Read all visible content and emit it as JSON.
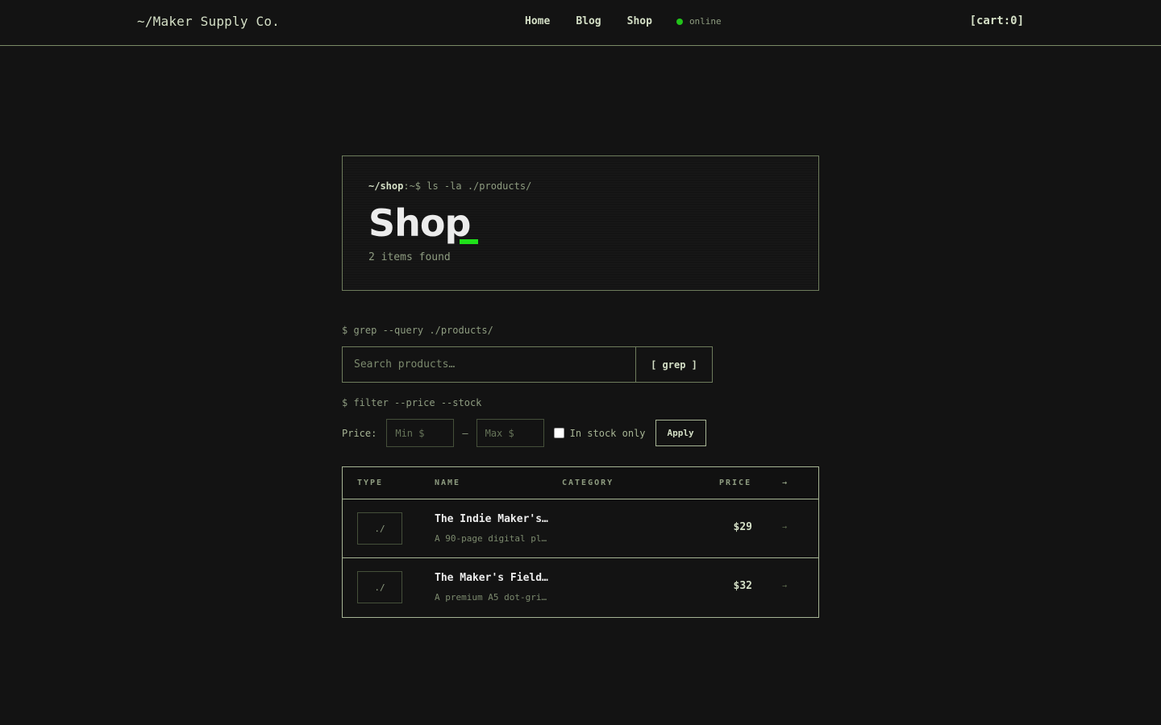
{
  "header": {
    "brand": "~/Maker Supply Co.",
    "nav": [
      "Home",
      "Blog",
      "Shop"
    ],
    "status": "online",
    "cart": "[cart:0]"
  },
  "hero": {
    "prompt_path": "~/shop",
    "prompt_cmd": ":~$ ls -la ./products/",
    "title": "Shop",
    "count": "2 items found"
  },
  "search": {
    "cmd": "$ grep --query ./products/",
    "placeholder": "Search products…",
    "button": "[ grep ]"
  },
  "filters": {
    "cmd": "$ filter --price --stock",
    "price_label": "Price:",
    "min_placeholder": "Min $",
    "dash": "—",
    "max_placeholder": "Max $",
    "in_stock_label": "In stock only",
    "in_stock_checked": false,
    "apply": "Apply"
  },
  "table": {
    "headers": [
      "TYPE",
      "NAME",
      "CATEGORY",
      "PRICE",
      "→"
    ],
    "rows": [
      {
        "type": "./",
        "name": "The Indie Maker's…",
        "desc": "A 90-page digital pl…",
        "category": "",
        "price": "$29",
        "arrow": "→"
      },
      {
        "type": "./",
        "name": "The Maker's Field…",
        "desc": "A premium A5 dot-gri…",
        "category": "",
        "price": "$32",
        "arrow": "→"
      }
    ]
  },
  "colors": {
    "background": "#131313",
    "accent": "#1fe01a",
    "border": "#a6b494"
  }
}
